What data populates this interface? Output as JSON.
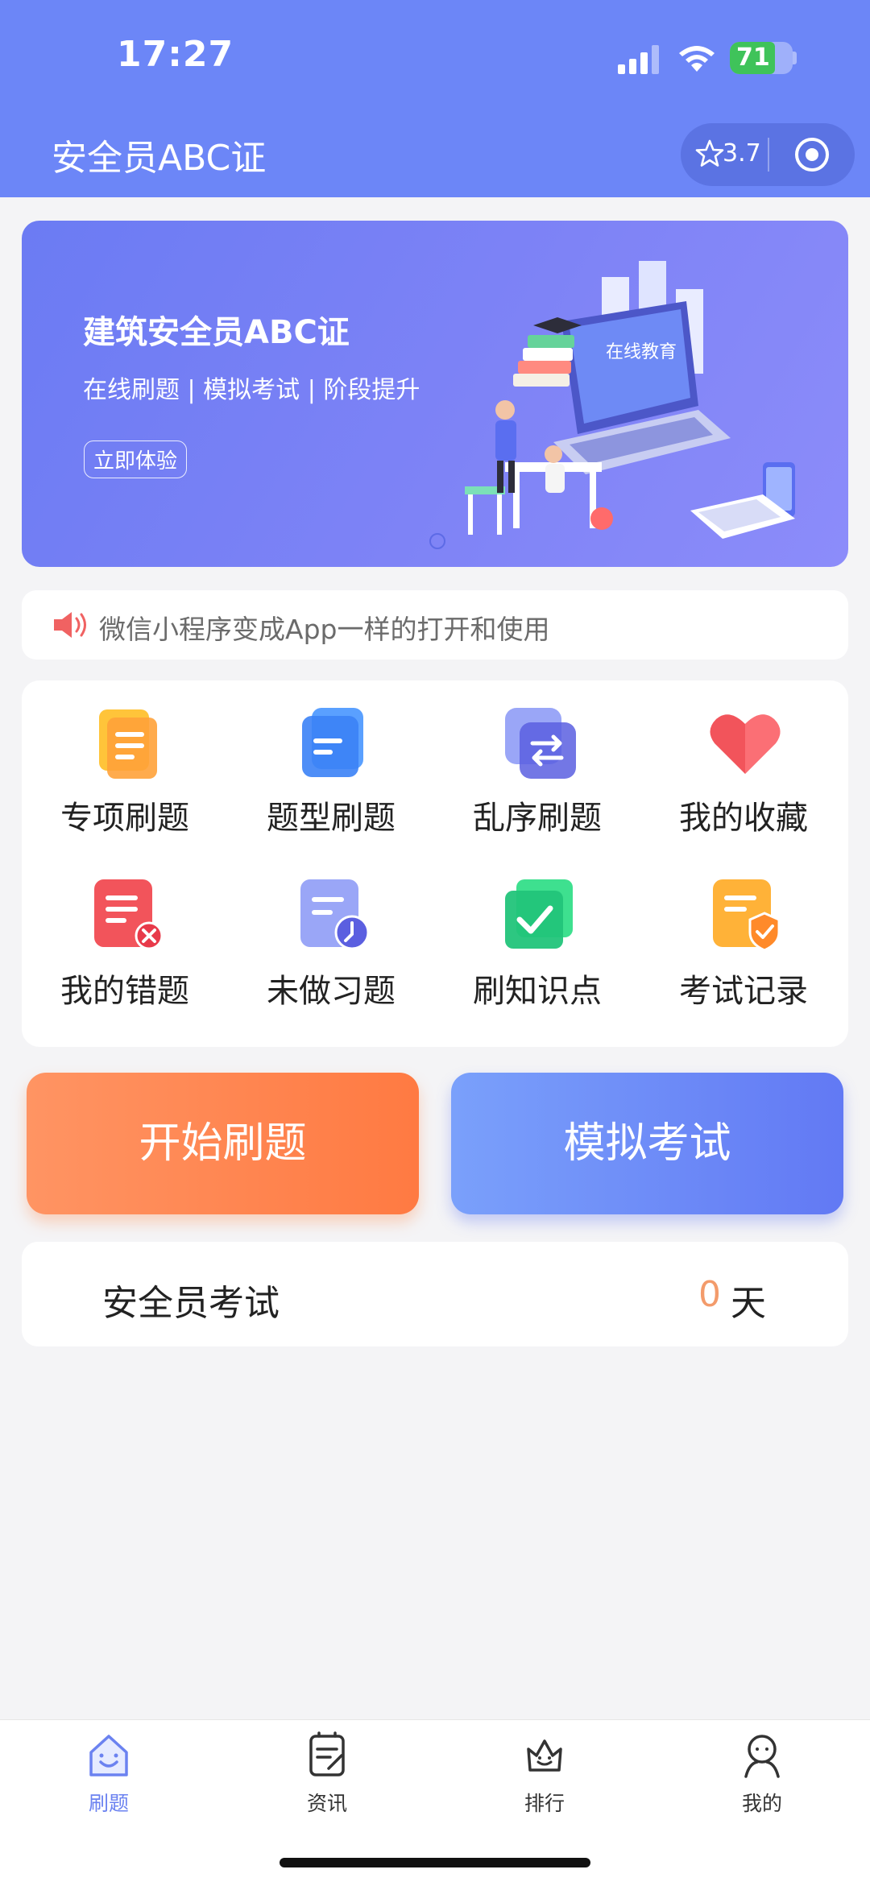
{
  "status_bar": {
    "time": "17:27",
    "battery": "71"
  },
  "nav": {
    "title": "安全员ABC证",
    "rating": "3.7",
    "star_icon": "star-outline-icon",
    "menu_icon": "target-icon"
  },
  "banner": {
    "title": "建筑安全员ABC证",
    "subtitle": "在线刷题 | 模拟考试 | 阶段提升",
    "button": "立即体验",
    "illustration_text": "在线教育"
  },
  "notice": {
    "icon": "speaker-icon",
    "text": "微信小程序变成App一样的打开和使用"
  },
  "grid": {
    "items": [
      {
        "label": "专项刷题",
        "icon": "document-orange-icon"
      },
      {
        "label": "题型刷题",
        "icon": "document-blue-icon"
      },
      {
        "label": "乱序刷题",
        "icon": "shuffle-icon"
      },
      {
        "label": "我的收藏",
        "icon": "heart-icon"
      },
      {
        "label": "我的错题",
        "icon": "wrong-answers-icon"
      },
      {
        "label": "未做习题",
        "icon": "clock-document-icon"
      },
      {
        "label": "刷知识点",
        "icon": "check-icon"
      },
      {
        "label": "考试记录",
        "icon": "shield-check-icon"
      }
    ]
  },
  "actions": {
    "start": "开始刷题",
    "exam": "模拟考试"
  },
  "countdown": {
    "label": "安全员考试",
    "days": "0",
    "unit": "天"
  },
  "tabbar": {
    "items": [
      {
        "label": "刷题",
        "icon": "home-icon",
        "active": true
      },
      {
        "label": "资讯",
        "icon": "news-icon",
        "active": false
      },
      {
        "label": "排行",
        "icon": "crown-icon",
        "active": false
      },
      {
        "label": "我的",
        "icon": "profile-icon",
        "active": false
      }
    ]
  },
  "colors": {
    "brand": "#6c86f7",
    "accent_orange": "#ff7a42",
    "countdown_number": "#f39b6b"
  }
}
